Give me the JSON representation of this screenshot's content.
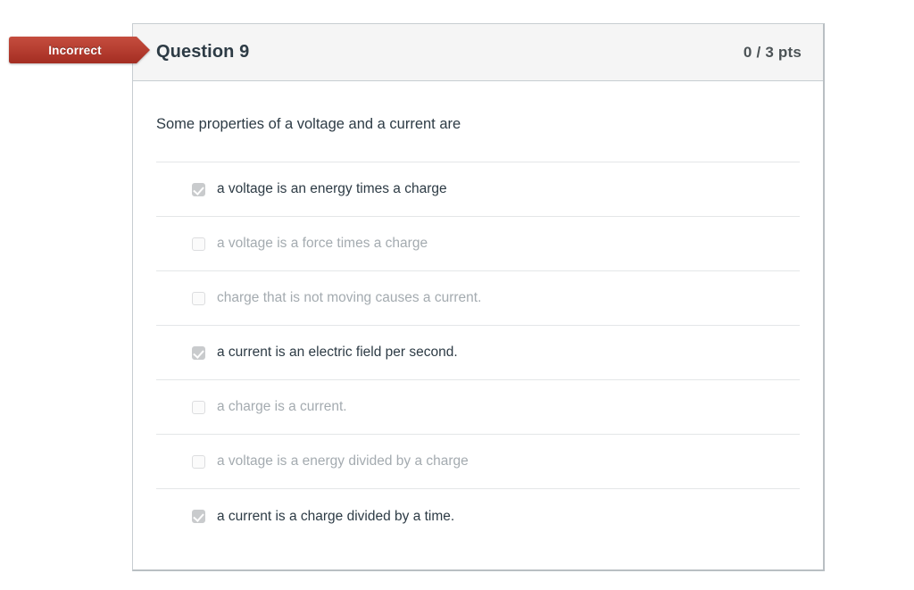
{
  "status_banner": {
    "label": "Incorrect",
    "color": "#b3372c",
    "gradient_top": "#c0483a",
    "gradient_bottom": "#a32d22"
  },
  "question": {
    "title": "Question 9",
    "points": "0 / 3 pts",
    "prompt": "Some properties of a voltage and a current are",
    "answers": [
      {
        "label": "a voltage is an energy times a charge",
        "checked": true
      },
      {
        "label": "a voltage is a force times a charge",
        "checked": false
      },
      {
        "label": "charge that is not moving causes a current.",
        "checked": false
      },
      {
        "label": "a current is an electric field per second.",
        "checked": true
      },
      {
        "label": "a charge is a current.",
        "checked": false
      },
      {
        "label": "a voltage is a energy divided by a charge",
        "checked": false
      },
      {
        "label": "a current is a charge divided by a time.",
        "checked": true
      }
    ]
  }
}
